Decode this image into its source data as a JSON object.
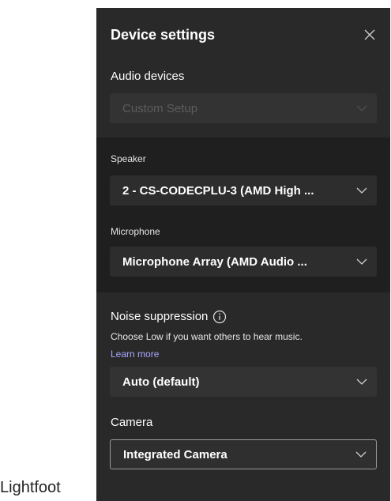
{
  "caption": "Lightfoot",
  "dialog": {
    "title": "Device settings",
    "close_icon": "close-icon"
  },
  "audio": {
    "label": "Audio devices",
    "value": "Custom Setup",
    "state": "disabled"
  },
  "speaker": {
    "label": "Speaker",
    "value": "2 - CS-CODECPLU-3 (AMD High ..."
  },
  "microphone": {
    "label": "Microphone",
    "value": "Microphone Array (AMD Audio ..."
  },
  "noise": {
    "label": "Noise suppression",
    "info_icon": "info-icon",
    "description": "Choose Low if you want others to hear music.",
    "learn_more": "Learn more",
    "value": "Auto (default)"
  },
  "camera": {
    "label": "Camera",
    "value": "Integrated Camera"
  },
  "colors": {
    "panel_bg": "#292929",
    "band_bg": "#1f1f1f",
    "link": "#a9a6ff"
  }
}
